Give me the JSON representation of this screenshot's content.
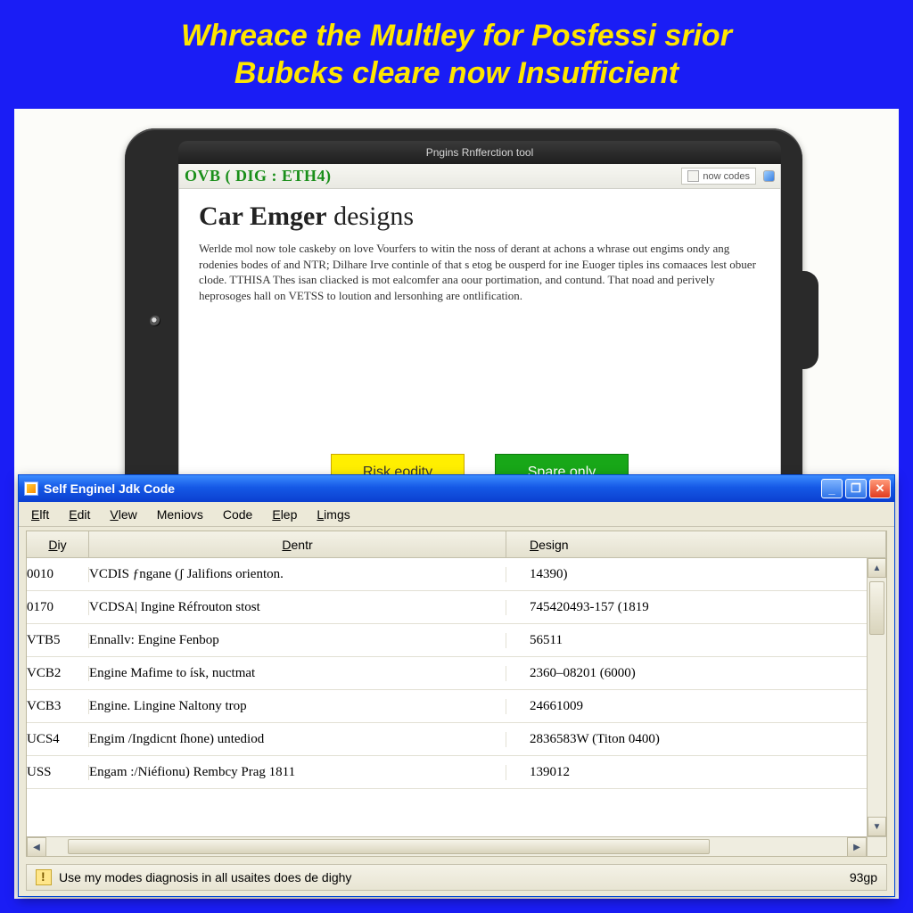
{
  "banner": {
    "line1": "Whreace the Multley for Posfessi srior",
    "line2": "Bubcks cleare now Insufficient"
  },
  "tablet": {
    "chrome_title": "Pngins Rnfferction tool",
    "address": "OVB ( DIG : ETH4)",
    "now_codes": "now codes",
    "heading_bold": "Car Emger",
    "heading_rest": " designs",
    "body": "Werlde mol now tole caskeby on love Vourfers to witin the noss of derant at achons a whrase out engims ondy ang rodenies bodes of and NTR; Dilhare Irve continle of that s etog be ousperd for ine Euoger tiples ins comaaces lest obuer clode. TTHISA Thes isan cliacked is mot ealcomfer ana oour portimation, and contund. That noad and perively heprosoges hall on VETSS to loution and lersonhing are ontlification.",
    "btn_risk": "Risk eodity",
    "btn_spare": "Spare only"
  },
  "win": {
    "title": "Self Enginel Jdk Code",
    "menu": [
      "Elft",
      "Edit",
      "Vlew",
      "Meniovs",
      "Code",
      "Elep",
      "Limgs"
    ],
    "cols": [
      "Diy",
      "Dentr",
      "Design"
    ],
    "rows": [
      {
        "c0": "0010",
        "c1": "VCDIS ƒngane (ʃ Jalifions orienton.",
        "c2": "14390)"
      },
      {
        "c0": "0170",
        "c1": "VCDSA| Ingine Réfrouton stost",
        "c2": "745420493-157 (1819"
      },
      {
        "c0": "VTB5",
        "c1": "Ennallv: Engine Fenbop",
        "c2": "56511"
      },
      {
        "c0": "VCB2",
        "c1": "Engine Mafime to ísk, nuctmat",
        "c2": "2360–08201 (6000)"
      },
      {
        "c0": "VCB3",
        "c1": "Engine. Lingine Naltony trop",
        "c2": "24661009"
      },
      {
        "c0": "UCS4",
        "c1": "Engim /Ingdicnt ſhone) untediod",
        "c2": "2836583W (Titon 0400)"
      },
      {
        "c0": "USS",
        "c1": "Engam :/Niéfionu) Rembcy Prag 1811",
        "c2": "139012"
      }
    ],
    "status_text": "Use my modes diagnosis in all usaites does de dighy",
    "status_right": "93gp"
  }
}
